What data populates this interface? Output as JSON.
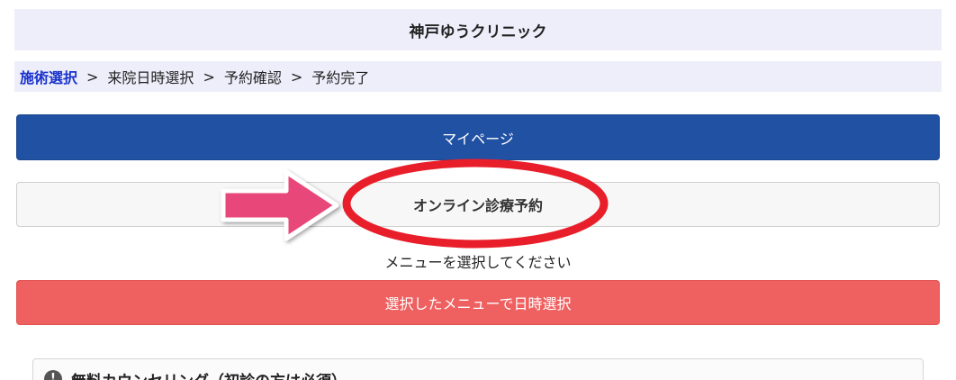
{
  "header": {
    "clinic_name": "神戸ゆうクリニック"
  },
  "breadcrumb": {
    "steps": [
      "施術選択",
      "来院日時選択",
      "予約確認",
      "予約完了"
    ],
    "separator": ">"
  },
  "buttons": {
    "mypage_label": "マイページ",
    "online_label": "オンライン診療予約",
    "submit_label": "選択したメニューで日時選択"
  },
  "instruction": "メニューを選択してください",
  "menu": {
    "first_item_title": "無料カウンセリング（初診の方は必須）",
    "info_icon_glyph": "!"
  },
  "colors": {
    "header_bg": "#eeeefb",
    "breadcrumb_active": "#1a33cc",
    "mypage_button": "#2151a3",
    "submit_button": "#ef6060",
    "annotation_red": "#e81f2a",
    "annotation_arrow": "#e8477a"
  }
}
